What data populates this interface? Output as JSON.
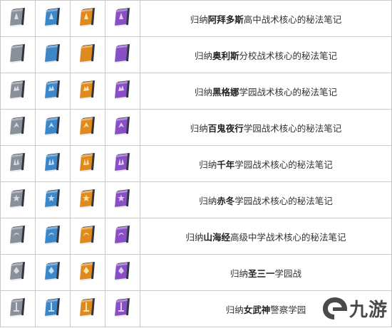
{
  "rows": [
    {
      "prefix": "归纳",
      "school": "阿拜多斯",
      "suffix": "高中战术核心的秘法笔记"
    },
    {
      "prefix": "归纳",
      "school": "奥利斯",
      "suffix": "分校战术核心的秘法笔记"
    },
    {
      "prefix": "归纳",
      "school": "黑格娜",
      "suffix": "学园战术核心的秘法笔记"
    },
    {
      "prefix": "归纳",
      "school": "百鬼夜行",
      "suffix": "学园战术核心的秘法笔记"
    },
    {
      "prefix": "归纳",
      "school": "千年",
      "suffix": "学园战术核心的秘法笔记"
    },
    {
      "prefix": "归纳",
      "school": "赤冬",
      "suffix": "学园战术核心的秘法笔记"
    },
    {
      "prefix": "归纳",
      "school": "山海经",
      "suffix": "高级中学战术核心的秘法笔记"
    },
    {
      "prefix": "归纳",
      "school": "圣三一",
      "suffix": "学园战"
    },
    {
      "prefix": "归纳",
      "school": "女武神",
      "suffix": "警察学园"
    }
  ],
  "tiers": [
    {
      "name": "gray",
      "color": "#8a9099",
      "accent": "#d7dbe0"
    },
    {
      "name": "blue",
      "color": "#3d87c9",
      "accent": "#bfe0f7"
    },
    {
      "name": "gold",
      "color": "#e08a1e",
      "accent": "#fbe3a8"
    },
    {
      "name": "purple",
      "color": "#8a4fc7",
      "accent": "#e2cff7"
    }
  ],
  "watermark": {
    "text": "九游"
  }
}
